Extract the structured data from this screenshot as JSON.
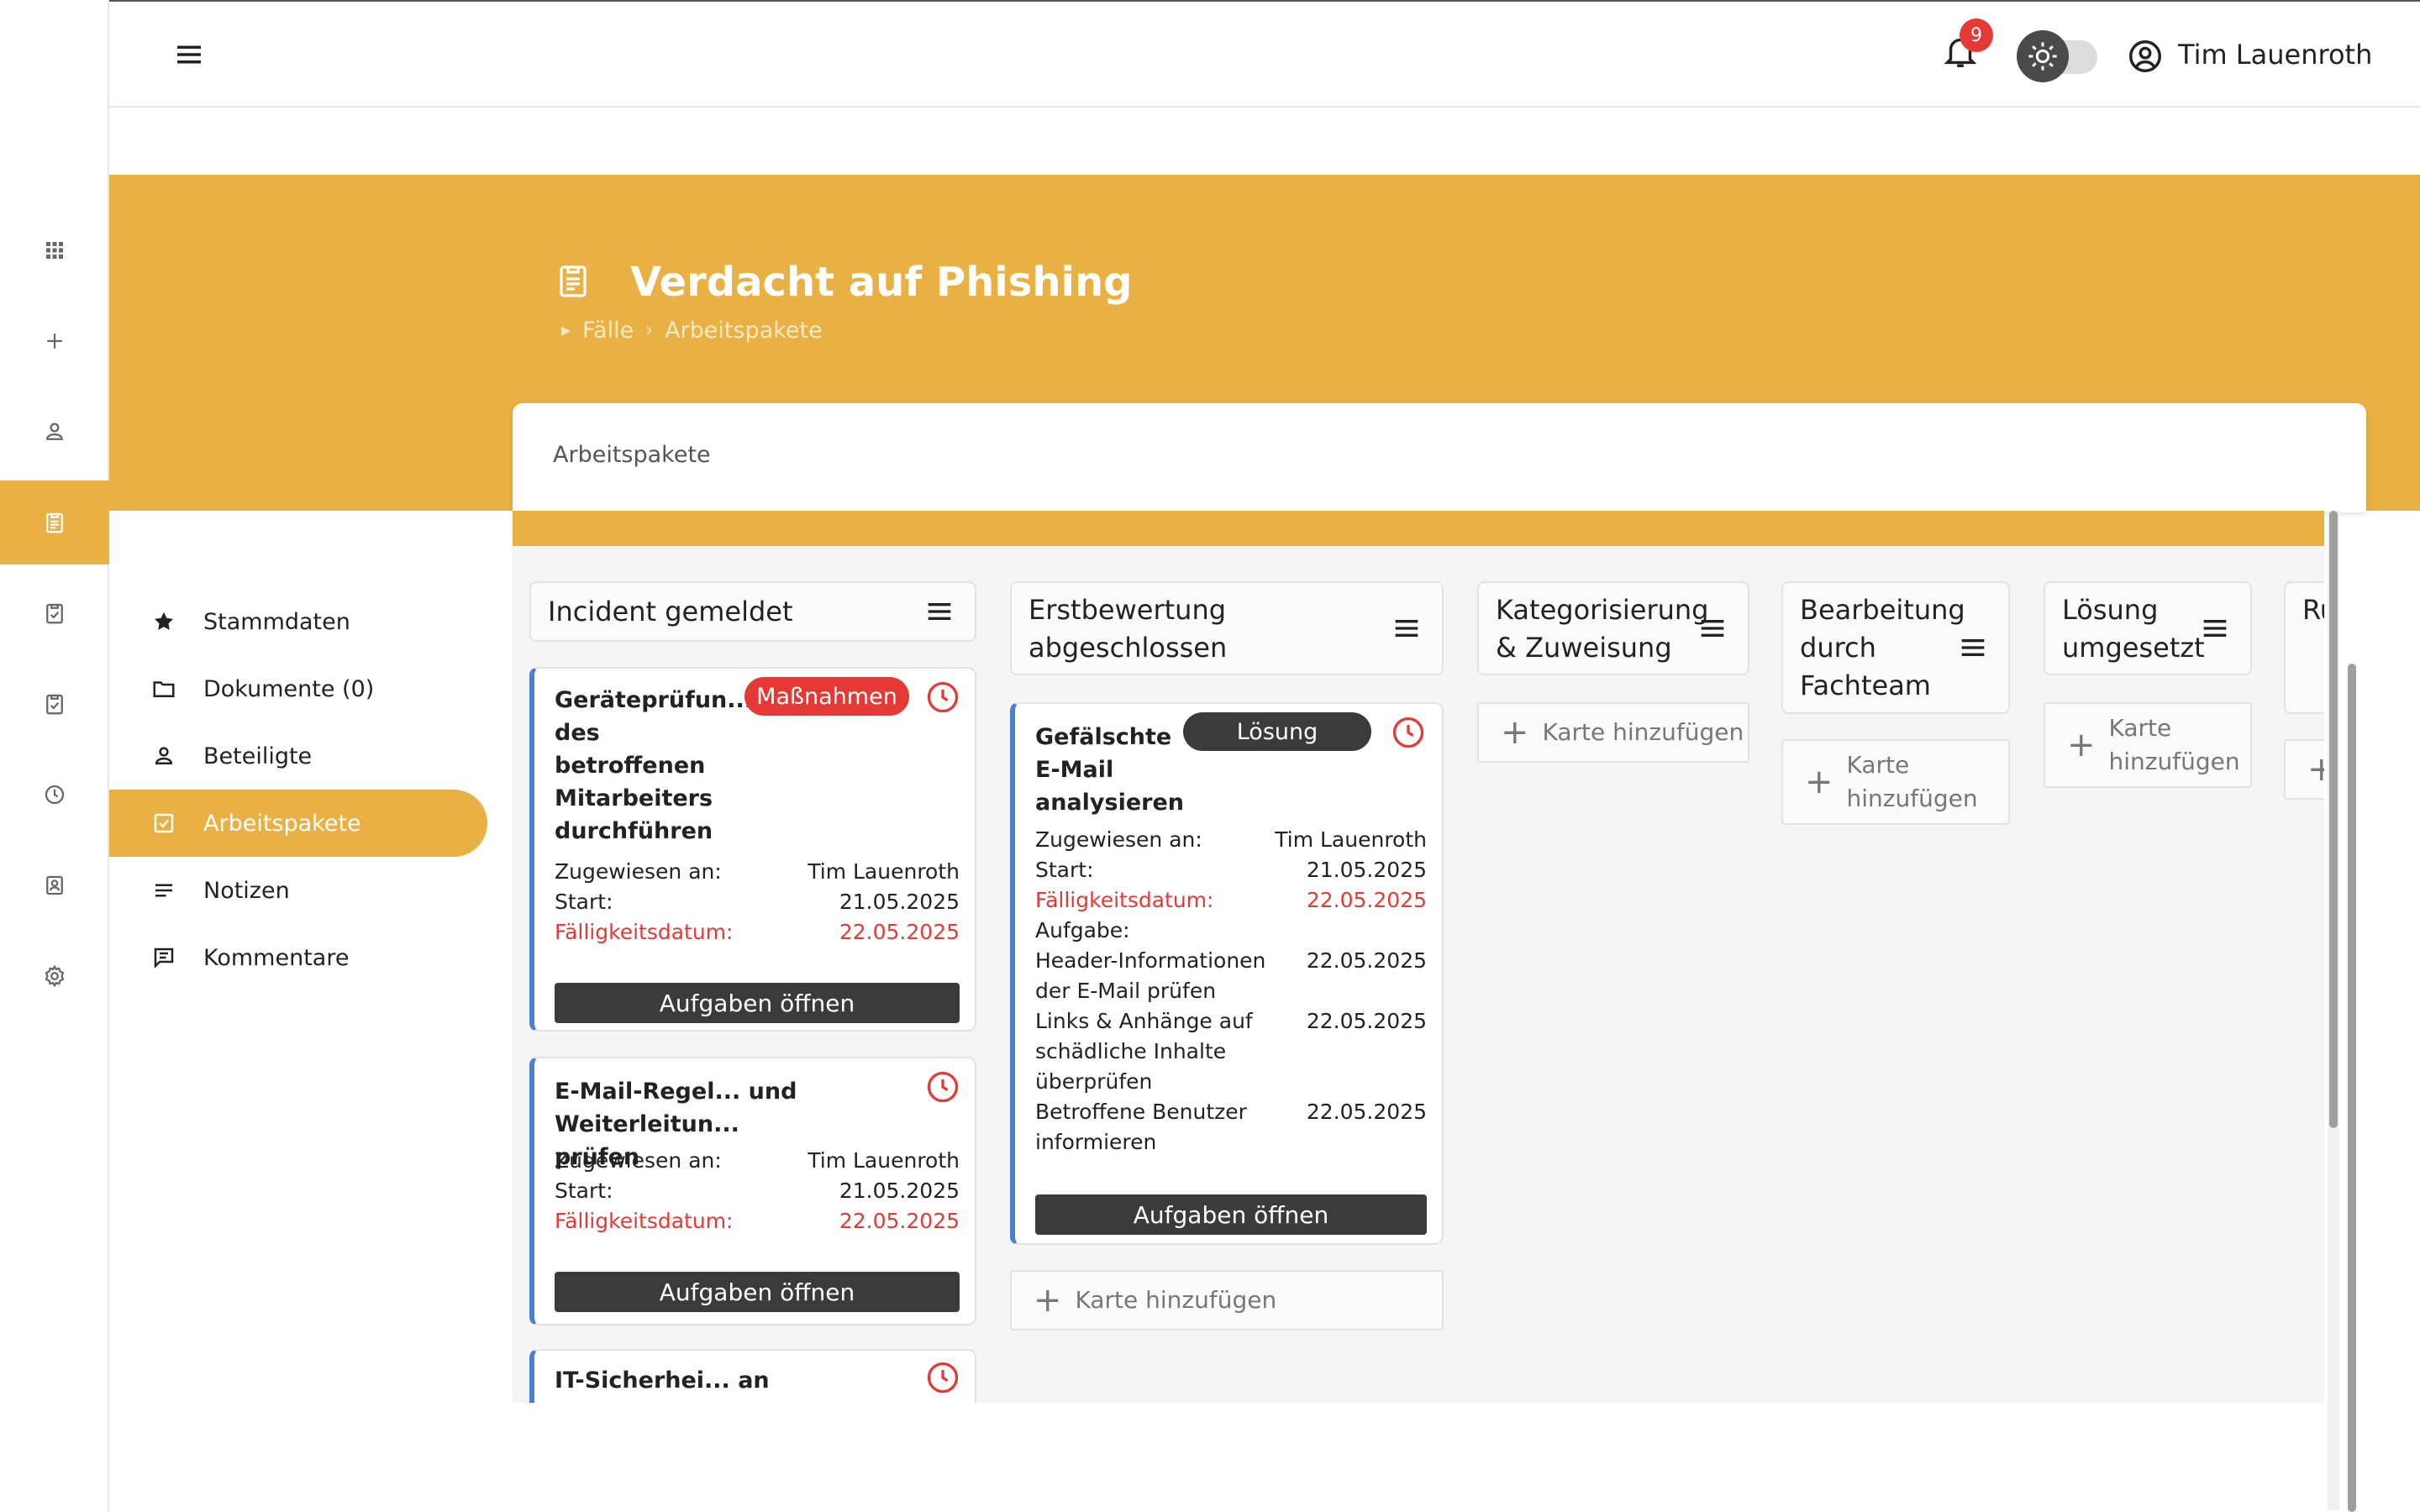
{
  "user": {
    "name": "Tim Lauenroth"
  },
  "notifications": {
    "count": "9"
  },
  "page": {
    "title": "Verdacht auf Phishing",
    "breadcrumb": [
      "Fälle",
      "Arbeitspakete"
    ],
    "card_header": "Arbeitspakete"
  },
  "rail": {
    "icons": [
      "apps-icon",
      "plus-icon",
      "person-icon",
      "clipboard-icon",
      "checklist-icon",
      "checklist-icon",
      "clock-icon",
      "contact-icon",
      "gear-icon"
    ],
    "active_index": 3
  },
  "sidenav": [
    {
      "label": "Stammdaten",
      "icon": "star-icon"
    },
    {
      "label": "Dokumente (0)",
      "icon": "folder-icon"
    },
    {
      "label": "Beteiligte",
      "icon": "person-icon"
    },
    {
      "label": "Arbeitspakete",
      "icon": "checkbox-icon",
      "active": true
    },
    {
      "label": "Notizen",
      "icon": "notes-icon"
    },
    {
      "label": "Kommentare",
      "icon": "comment-icon"
    }
  ],
  "board": {
    "add_card_label": "Karte hinzufügen",
    "columns": [
      {
        "title": "Incident gemeldet"
      },
      {
        "title": "Erstbewertung abgeschlossen"
      },
      {
        "title": "Kategorisierung & Zuweisung"
      },
      {
        "title": "Bearbeitung durch Fachteam"
      },
      {
        "title": "Lösung umgesetzt"
      },
      {
        "title": "Ru & Do"
      }
    ],
    "labels": {
      "assigned": "Zugewiesen an:",
      "start": "Start:",
      "due": "Fälligkeitsdatum:",
      "tasks": "Aufgabe:",
      "open_tasks": "Aufgaben öffnen"
    },
    "cards": [
      {
        "title": "Geräteprüfun... des betroffenen Mitarbeiters durchführen",
        "badge": "Maßnahmen",
        "assignee": "Tim Lauenroth",
        "start": "21.05.2025",
        "due": "22.05.2025"
      },
      {
        "title": "E-Mail-Regel... und Weiterleitun... prüfen",
        "assignee": "Tim Lauenroth",
        "start": "21.05.2025",
        "due": "22.05.2025"
      },
      {
        "title": "IT-Sicherhei... an"
      },
      {
        "title": "Gefälschte E-Mail analysieren",
        "badge": "Lösung",
        "assignee": "Tim Lauenroth",
        "start": "21.05.2025",
        "due": "22.05.2025",
        "tasks": [
          {
            "text": "Header-Informationen der E-Mail prüfen",
            "date": "22.05.2025"
          },
          {
            "text": "Links & Anhänge auf schädliche Inhalte überprüfen",
            "date": "22.05.2025"
          },
          {
            "text": "Betroffene Benutzer informieren",
            "date": "22.05.2025"
          }
        ]
      }
    ]
  },
  "colors": {
    "accent": "#e9b043",
    "card_border": "#4a7fd4",
    "due_red": "#e53935",
    "badge_red": "#e53935",
    "badge_dark": "#3b3b3b"
  }
}
